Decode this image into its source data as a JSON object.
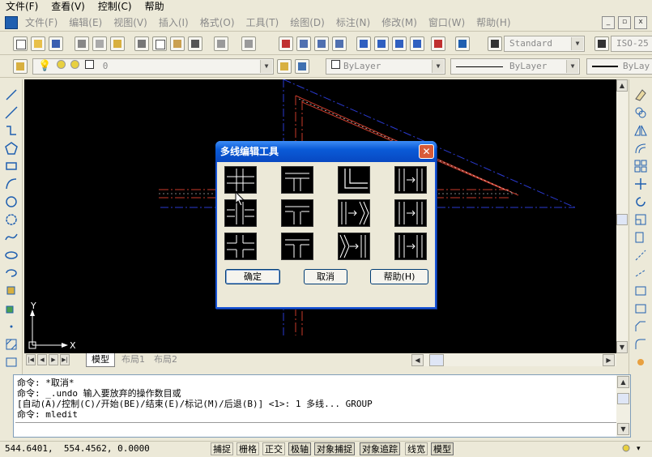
{
  "outer_menu": [
    "文件(F)",
    "查看(V)",
    "控制(C)",
    "帮助"
  ],
  "inner_menu": [
    "文件(F)",
    "编辑(E)",
    "视图(V)",
    "插入(I)",
    "格式(O)",
    "工具(T)",
    "绘图(D)",
    "标注(N)",
    "修改(M)",
    "窗口(W)",
    "帮助(H)"
  ],
  "toolbar1": {
    "text_style": "Standard",
    "dim_style": "ISO-25"
  },
  "toolbar2": {
    "layer": "0",
    "color": "ByLayer",
    "linetype": "ByLayer",
    "lineweight": "ByLay"
  },
  "canvas": {
    "ucs_y": "Y",
    "ucs_x": "X"
  },
  "tabs": [
    "模型",
    "布局1",
    "布局2"
  ],
  "dialog": {
    "title": "多线编辑工具",
    "close": "✕",
    "ok": "确定",
    "cancel": "取消",
    "help": "帮助(H)"
  },
  "command_lines": [
    "命令: *取消*",
    "命令: _.undo 输入要放弃的操作数目或",
    "[自动(A)/控制(C)/开始(BE)/结束(E)/标记(M)/后退(B)] <1>: 1 多线... GROUP",
    "命令: mledit"
  ],
  "status": {
    "coords": "544.6401,  554.4562, 0.0000",
    "buttons": [
      "捕捉",
      "栅格",
      "正交",
      "极轴",
      "对象捕捉",
      "对象追踪",
      "线宽",
      "模型"
    ]
  },
  "colors": {
    "canvas": "#000000",
    "title_blue": "#0a5bd7",
    "mline_red": "#c83a2a",
    "mline_blue": "#2a3ad0"
  }
}
